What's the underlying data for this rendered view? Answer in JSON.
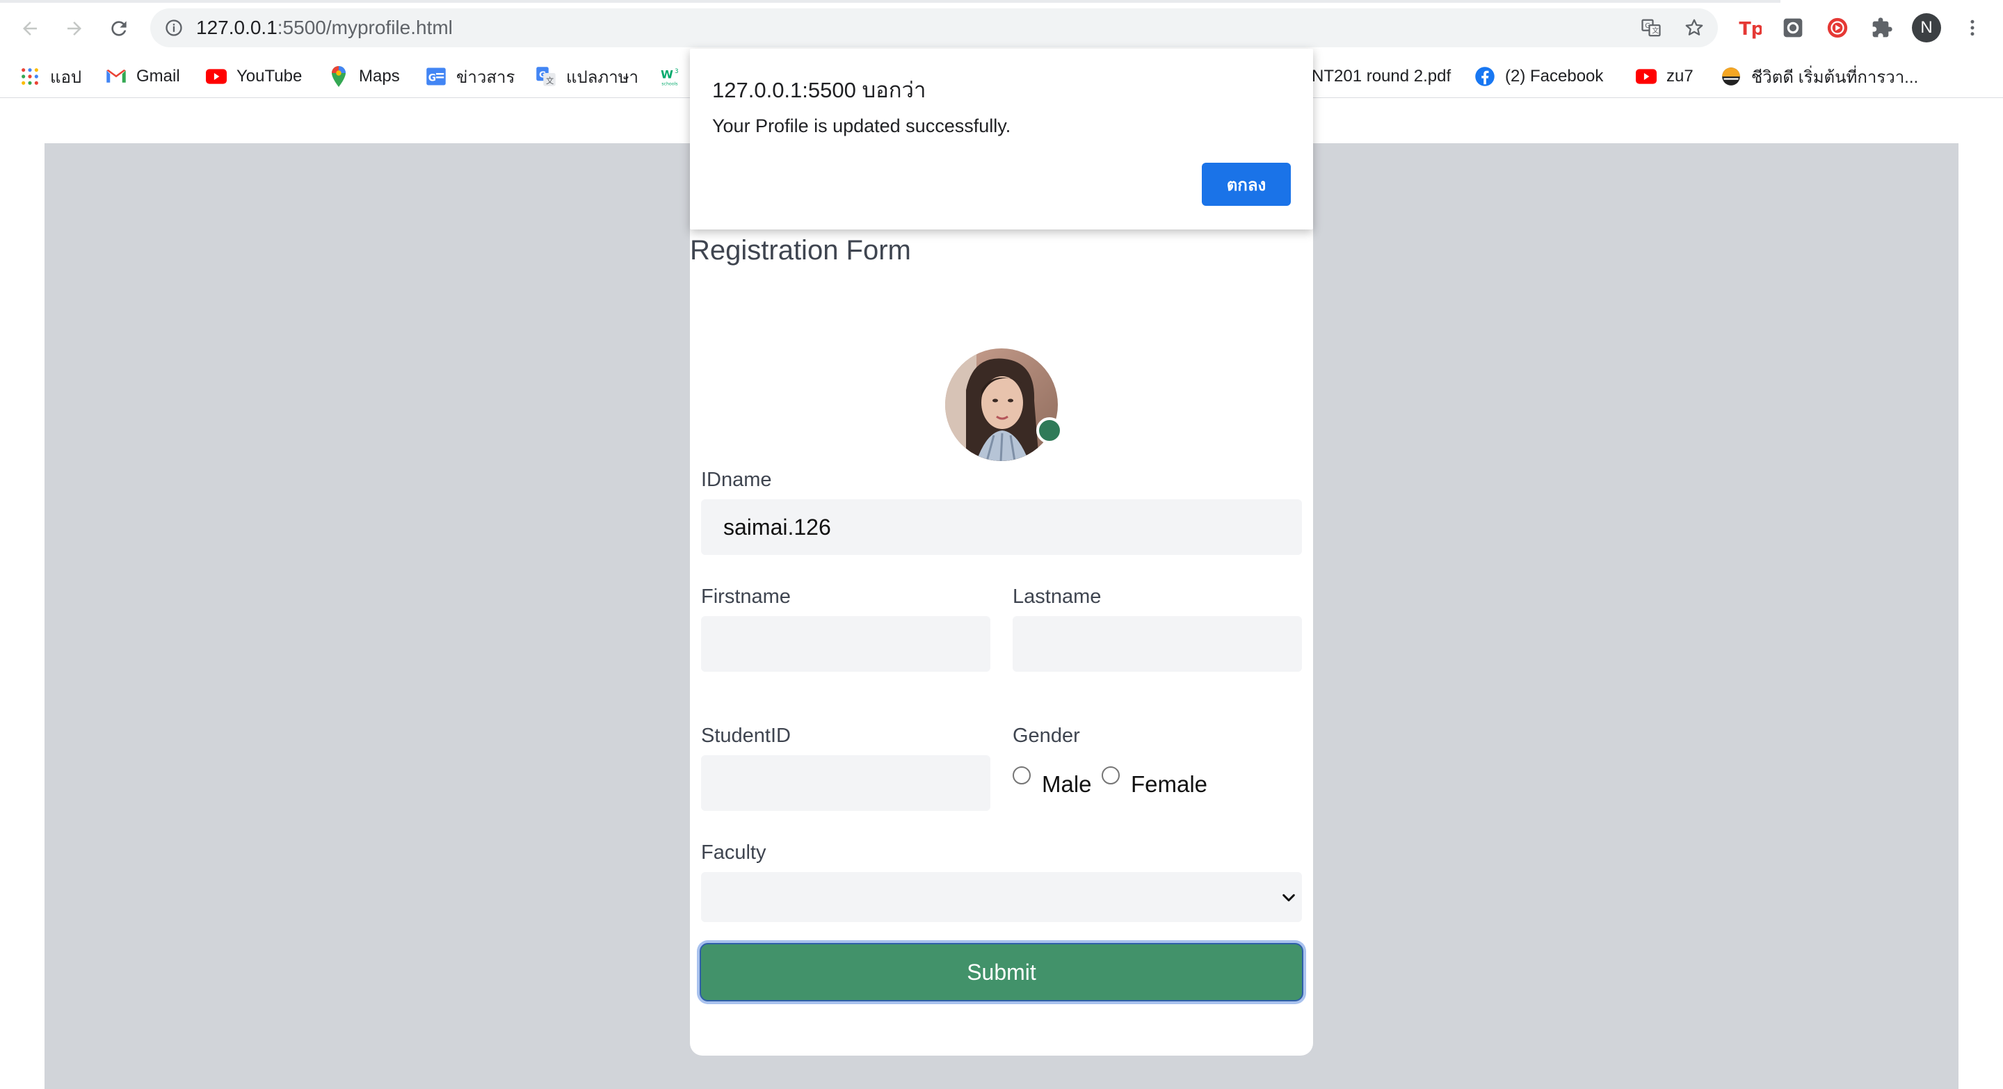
{
  "browser": {
    "url_host": "127.0.0.1",
    "url_rest": ":5500/myprofile.html",
    "profile_initial": "N"
  },
  "bookmarks": [
    {
      "label": "แอป",
      "icon": "apps-grid-icon"
    },
    {
      "label": "Gmail",
      "icon": "gmail-icon"
    },
    {
      "label": "YouTube",
      "icon": "youtube-icon"
    },
    {
      "label": "Maps",
      "icon": "maps-icon"
    },
    {
      "label": "ข่าวสาร",
      "icon": "news-icon"
    },
    {
      "label": "แปลภาษา",
      "icon": "translate-icon"
    },
    {
      "label": "",
      "icon": "w3schools-icon"
    },
    {
      "label": "NT201 round 2.pdf",
      "icon": ""
    },
    {
      "label": "(2) Facebook",
      "icon": "facebook-icon"
    },
    {
      "label": "zu7",
      "icon": "youtube-icon"
    },
    {
      "label": "ชีวิตดี เริ่มต้นที่การวา...",
      "icon": "site-icon"
    }
  ],
  "dialog": {
    "title": "127.0.0.1:5500 บอกว่า",
    "message": "Your Profile is updated successfully.",
    "ok_label": "ตกลง"
  },
  "form": {
    "title": "Registration Form",
    "idname_label": "IDname",
    "idname_value": "saimai.126",
    "firstname_label": "Firstname",
    "firstname_value": "",
    "lastname_label": "Lastname",
    "lastname_value": "",
    "studentid_label": "StudentID",
    "studentid_value": "",
    "gender_label": "Gender",
    "gender_options": [
      "Male",
      "Female"
    ],
    "faculty_label": "Faculty",
    "faculty_value": "",
    "submit_label": "Submit"
  },
  "colors": {
    "submit_bg": "#42926a",
    "online_dot": "#2f7a58",
    "dialog_button": "#1a73e8",
    "backdrop": "#d1d4d9"
  }
}
